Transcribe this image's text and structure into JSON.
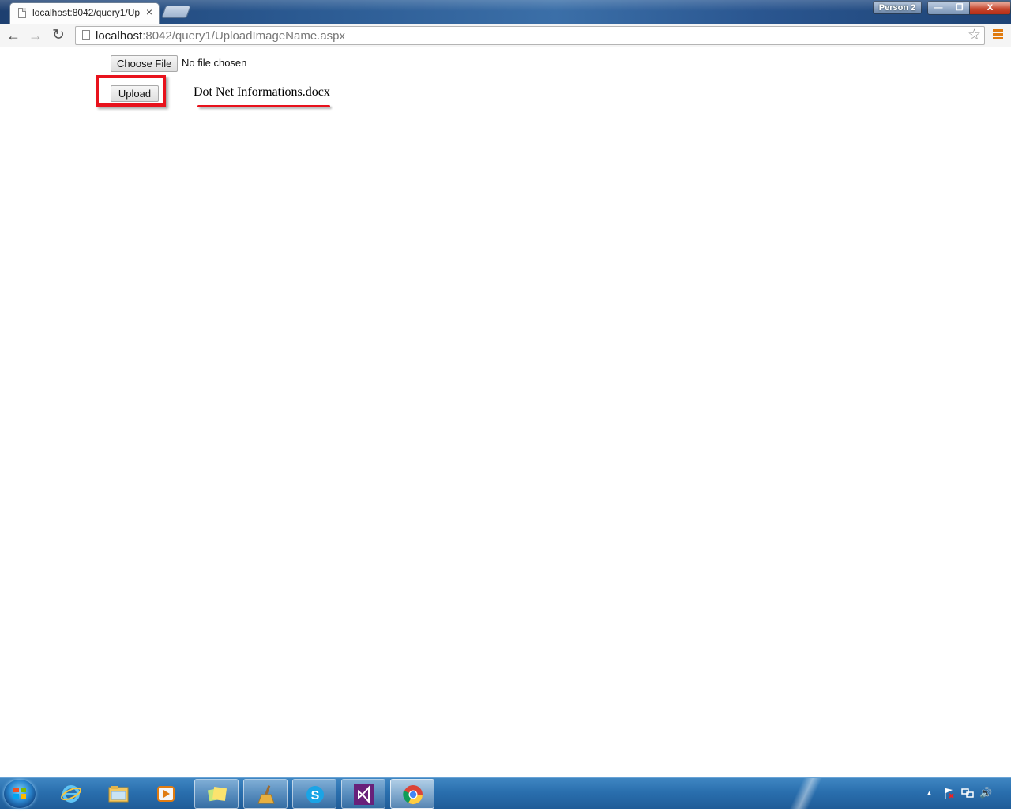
{
  "browser": {
    "tab_title": "localhost:8042/query1/Up",
    "tab_close": "×",
    "profile_label": "Person 2",
    "window_min": "—",
    "window_max": "❐",
    "window_close": "X",
    "url_host": "localhost",
    "url_path": ":8042/query1/UploadImageName.aspx",
    "back_glyph": "←",
    "forward_glyph": "→",
    "reload_glyph": "↻",
    "star_glyph": "☆"
  },
  "page": {
    "choose_file_label": "Choose File",
    "no_file_text": "No file chosen",
    "upload_label": "Upload",
    "uploaded_file_name": "Dot Net Informations.docx",
    "highlight_color": "#e8121c"
  },
  "taskbar": {
    "items": [
      "start-orb",
      "internet-explorer-icon",
      "file-explorer-icon",
      "media-player-icon",
      "sticky-notes-icon",
      "ccleaner-icon",
      "skype-icon",
      "visual-studio-icon",
      "chrome-icon"
    ],
    "tray_up": "▲",
    "tray_speaker": "🔊"
  }
}
